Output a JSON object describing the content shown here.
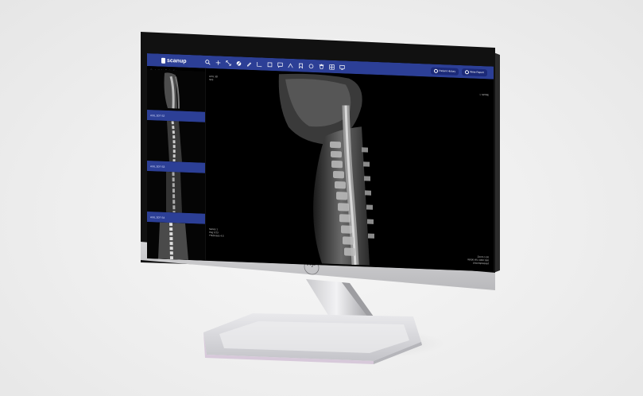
{
  "app": {
    "brand": "scanup"
  },
  "toolbar": {
    "icons": [
      "zoom-icon",
      "pan-icon",
      "expand-icon",
      "contrast-icon",
      "pen-icon",
      "measure-icon",
      "square-icon",
      "comment-icon",
      "angle-icon",
      "bookmark-icon",
      "circle-icon",
      "trash-icon",
      "grid-icon",
      "monitor-icon"
    ],
    "patient_history": "Patient History",
    "write_report": "Write Report"
  },
  "sidebar": {
    "breadcrumb_home": "Study List",
    "breadcrumb_sep": ">",
    "breadcrumb_current": "Series list",
    "series": [
      {
        "label": "AXIL 3D? S2"
      },
      {
        "label": "AXIL 3D? S3"
      },
      {
        "label": "AXIL 3D? S4"
      }
    ]
  },
  "viewer": {
    "top_left": [
      "AXIL 3D",
      "S18"
    ],
    "top_right": "L SPINE",
    "bottom_left": [
      "Series 1",
      "Img 1/23",
      "Thickness 4.5"
    ],
    "bottom_right": [
      "Zoom 1.00",
      "W500 WL 1000 S30",
      "Uncompressed"
    ]
  },
  "hardware": {
    "logo": "hp"
  }
}
